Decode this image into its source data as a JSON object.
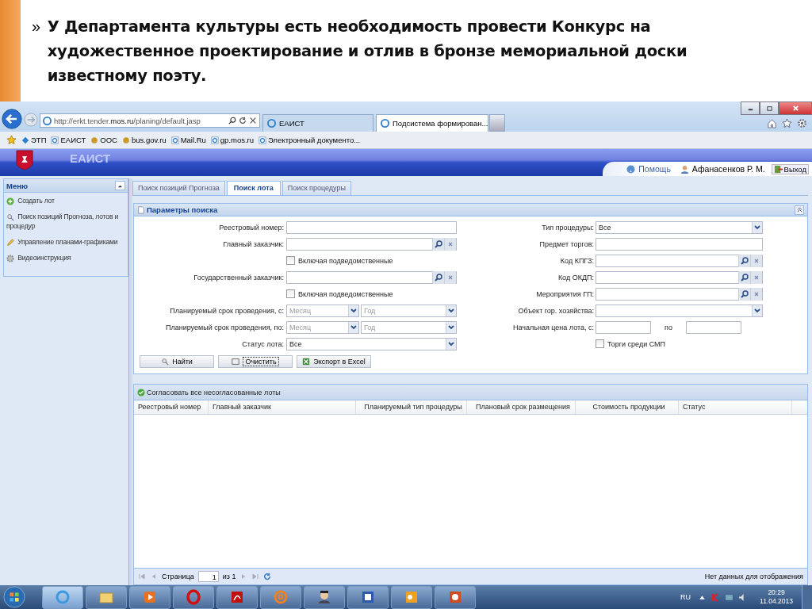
{
  "slide": {
    "bullet": "»",
    "text": "У Департамента культуры есть необходимость провести Конкурс на художественное проектирование и отлив в бронзе мемориальной доски известному поэту."
  },
  "browser": {
    "address_plain": "http://erkt.tender.",
    "address_bold": "mos.ru",
    "address_rest": "/planing/default.jasp",
    "tabs": [
      {
        "label": "ЕАИСТ",
        "selected": false
      },
      {
        "label": "Подсистема формирован...",
        "selected": true
      }
    ],
    "favorites": [
      "ЭТП",
      "ЕАИСТ",
      "ООС",
      "bus.gov.ru",
      "Mail.Ru",
      "gp.mos.ru",
      "Электронный документо..."
    ]
  },
  "app": {
    "logo_text": "ЕАИСТ",
    "help": "Помощь",
    "user": "Афанасенков Р. М.",
    "exit": "Выход"
  },
  "menu": {
    "title": "Меню",
    "items": [
      "Создать лот",
      "Поиск позиций Прогноза, лотов и процедур",
      "Управление планами-графиками",
      "Видеоинструкция"
    ]
  },
  "search_tabs": [
    {
      "label": "Поиск позиций Прогноза",
      "selected": false
    },
    {
      "label": "Поиск лота",
      "selected": true
    },
    {
      "label": "Поиск процедуры",
      "selected": false
    }
  ],
  "search_panel": {
    "title": "Параметры поиска",
    "left_fields": [
      {
        "kind": "text",
        "label": "Реестровый номер:"
      },
      {
        "kind": "lookup",
        "label": "Главный заказчик:"
      },
      {
        "kind": "checkbox",
        "label": "Включая подведомственные",
        "checked": false
      },
      {
        "kind": "lookup",
        "label": "Государственный заказчик:"
      },
      {
        "kind": "checkbox",
        "label": "Включая подведомственные",
        "checked": false
      },
      {
        "kind": "period",
        "label": "Планируемый срок проведения, с:",
        "placeholder": "Месяц",
        "placeholder_2": "Год"
      },
      {
        "kind": "period",
        "label": "Планируемый срок проведения, по:",
        "placeholder": "Месяц",
        "placeholder_2": "Год"
      },
      {
        "kind": "select",
        "label": "Статус лота:",
        "value": "Все"
      }
    ],
    "right_fields": [
      {
        "kind": "select",
        "label": "Тип процедуры:",
        "value": "Все"
      },
      {
        "kind": "text",
        "label": "Предмет торгов:"
      },
      {
        "kind": "lookup",
        "label": "Код КПГЗ:"
      },
      {
        "kind": "lookup",
        "label": "Код ОКДП:"
      },
      {
        "kind": "lookup",
        "label": "Мероприятия ГП:"
      },
      {
        "kind": "select",
        "label": "Объект гор. хозяйства:"
      },
      {
        "kind": "range",
        "label": "Начальная цена лота, с:",
        "separator": "по"
      },
      {
        "kind": "checkbox",
        "label": "Торги среди СМП",
        "checked": false
      }
    ],
    "buttons": [
      "Найти",
      "Очистить",
      "Экспорт в Excel"
    ]
  },
  "results": {
    "action": "Согласовать все несогласованные лоты",
    "columns": [
      "Реестровый номер",
      "Главный заказчик",
      "Планируемый тип процедуры",
      "Плановый срок размещения",
      "Стоимость продукции",
      "Статус"
    ],
    "pager": {
      "page_label": "Страница",
      "page": "1",
      "of": "из 1",
      "status": "Нет данных для отображения"
    }
  },
  "taskbar": {
    "language": "RU",
    "time": "20:29",
    "date": "11.04.2013"
  }
}
